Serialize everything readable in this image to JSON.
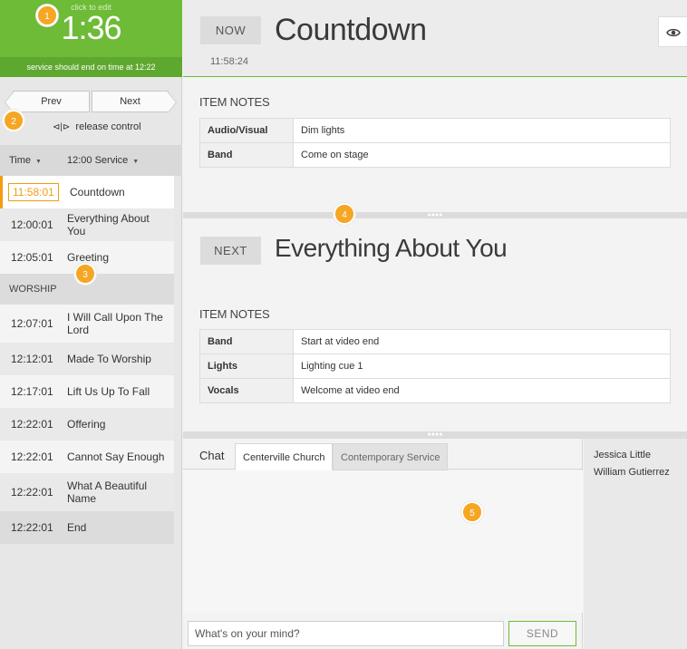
{
  "clock": {
    "hint": "click to edit",
    "time": "1:36",
    "status": "service should end on time at 12:22"
  },
  "nav": {
    "prev_label": "Prev",
    "next_label": "Next",
    "release_label": "release control"
  },
  "list_header": {
    "time_label": "Time",
    "service_label": "12:00 Service"
  },
  "items": [
    {
      "time": "11:58:01",
      "name": "Countdown"
    },
    {
      "time": "12:00:01",
      "name": "Everything About You"
    },
    {
      "time": "12:05:01",
      "name": "Greeting"
    },
    {
      "header": "WORSHIP"
    },
    {
      "time": "12:07:01",
      "name": "I Will Call Upon The Lord"
    },
    {
      "time": "12:12:01",
      "name": "Made To Worship"
    },
    {
      "time": "12:17:01",
      "name": "Lift Us Up To Fall"
    },
    {
      "time": "12:22:01",
      "name": "Offering"
    },
    {
      "time": "12:22:01",
      "name": "Cannot Say Enough"
    },
    {
      "time": "12:22:01",
      "name": "What A Beautiful Name"
    },
    {
      "time": "12:22:01",
      "name": "End"
    }
  ],
  "now": {
    "tag": "NOW",
    "title": "Countdown",
    "time": "11:58:24",
    "notes_title": "ITEM NOTES",
    "notes": [
      {
        "key": "Audio/Visual",
        "value": "Dim lights"
      },
      {
        "key": "Band",
        "value": "Come on stage"
      }
    ]
  },
  "next": {
    "tag": "NEXT",
    "title": "Everything About You",
    "notes_title": "ITEM NOTES",
    "notes": [
      {
        "key": "Band",
        "value": "Start at video end"
      },
      {
        "key": "Lights",
        "value": "Lighting cue 1"
      },
      {
        "key": "Vocals",
        "value": "Welcome at video end"
      }
    ]
  },
  "chat": {
    "tabs": [
      "Chat",
      "Centerville Church",
      "Contemporary Service"
    ],
    "placeholder": "What's on your mind?",
    "send_label": "SEND"
  },
  "users": [
    "Jessica Little",
    "William Gutierrez"
  ],
  "badges": [
    "1",
    "2",
    "3",
    "4",
    "5"
  ],
  "colors": {
    "accent_green": "#6dbb37",
    "accent_orange": "#f39c12",
    "badge": "#f5a623"
  },
  "icons": {
    "eye": "eye-icon",
    "release": "release-control-icon",
    "caret": "caret-down-icon"
  }
}
